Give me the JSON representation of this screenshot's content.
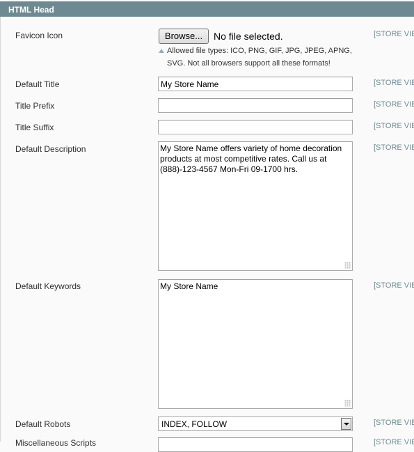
{
  "section": {
    "title": "HTML Head"
  },
  "scope_label": "[STORE VIEW]",
  "fields": {
    "favicon": {
      "label": "Favicon Icon",
      "browse_label": "Browse...",
      "file_status": "No file selected.",
      "note_line1": "Allowed file types: ICO, PNG, GIF, JPG, JPEG, APNG,",
      "note_line2": "SVG. Not all browsers support all these formats!"
    },
    "default_title": {
      "label": "Default Title",
      "value": "My Store Name"
    },
    "title_prefix": {
      "label": "Title Prefix",
      "value": ""
    },
    "title_suffix": {
      "label": "Title Suffix",
      "value": ""
    },
    "default_description": {
      "label": "Default Description",
      "value": "My Store Name offers variety of home decoration products at most competitive rates. Call us at (888)-123-4567 Mon-Fri 09-1700 hrs."
    },
    "default_keywords": {
      "label": "Default Keywords",
      "value": "My Store Name"
    },
    "default_robots": {
      "label": "Default Robots",
      "value": "INDEX, FOLLOW"
    },
    "misc_scripts": {
      "label": "Miscellaneous Scripts",
      "value": ""
    }
  }
}
